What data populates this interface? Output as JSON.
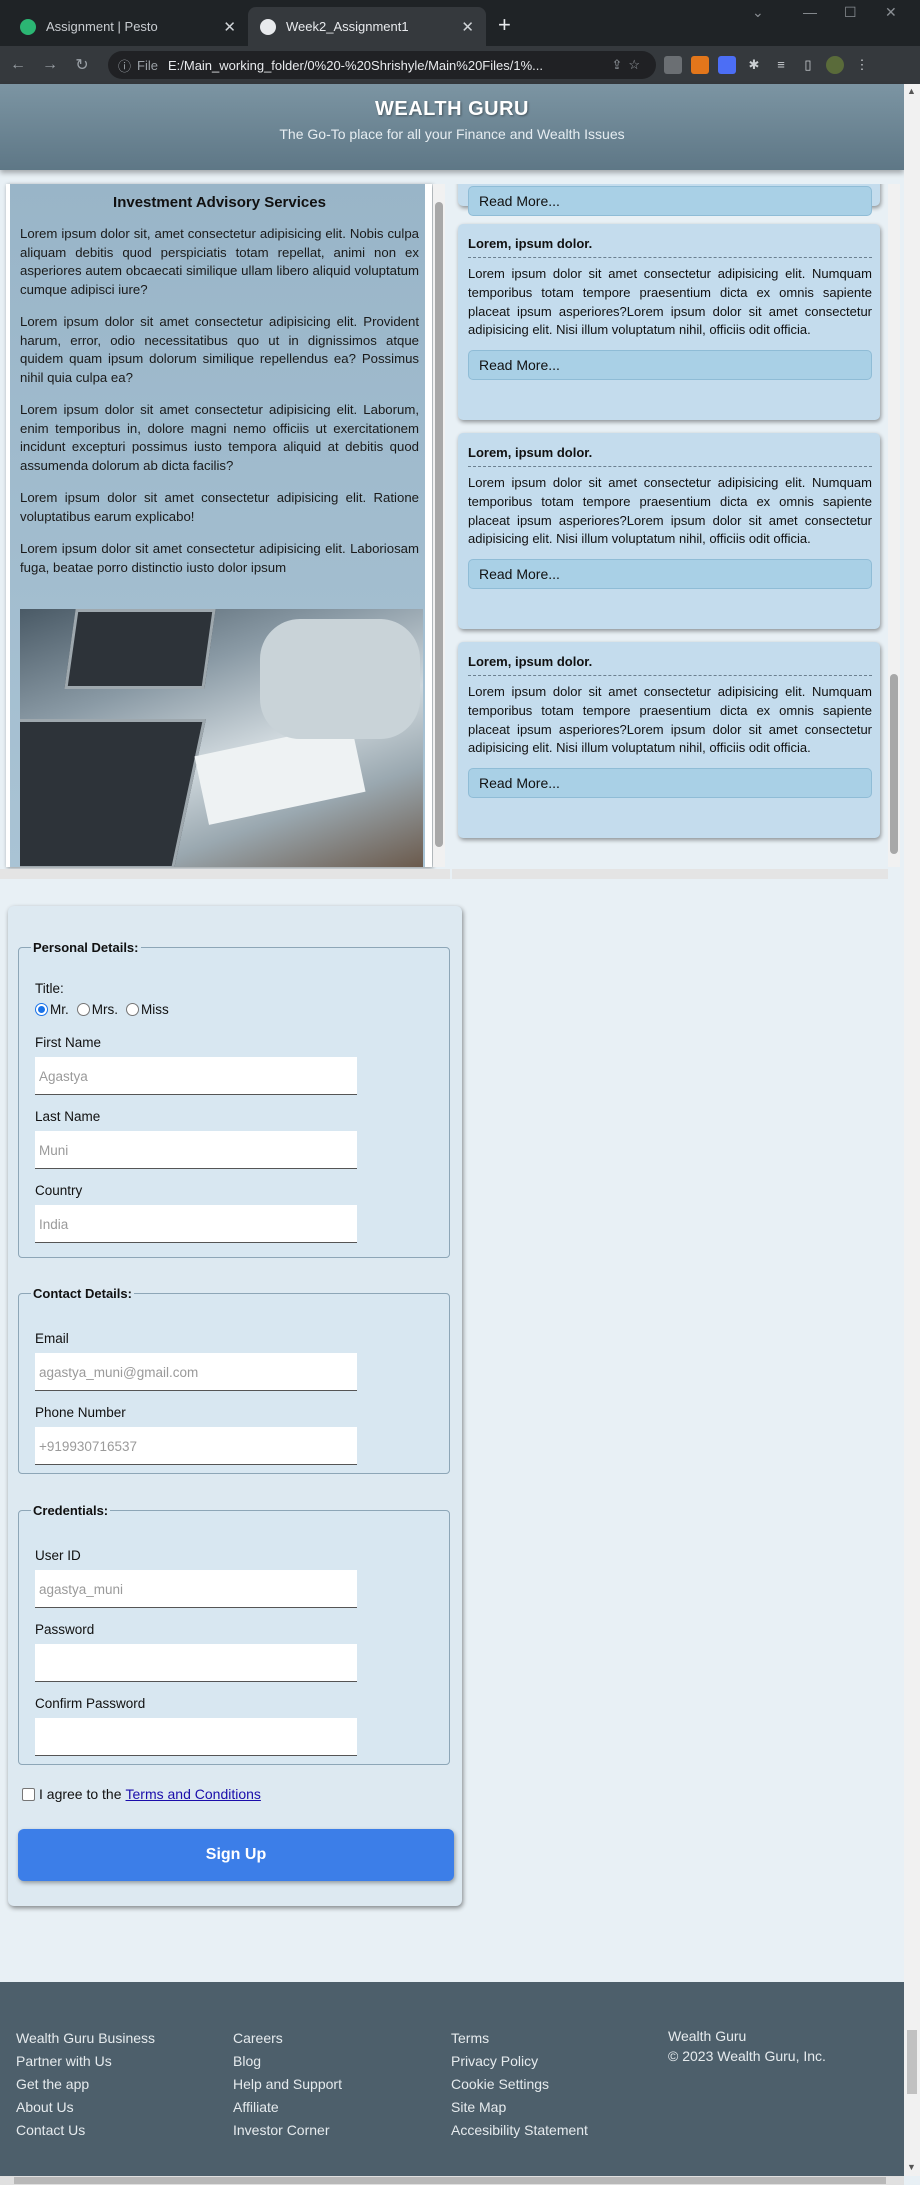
{
  "browser": {
    "tabs": [
      {
        "title": "Assignment | Pesto",
        "active": false
      },
      {
        "title": "Week2_Assignment1",
        "active": true
      }
    ],
    "address": {
      "scheme_label": "File",
      "url": "E:/Main_working_folder/0%20-%20Shrishyle/Main%20Files/1%..."
    }
  },
  "header": {
    "brand": "WEALTH GURU",
    "tagline": "The Go-To place for all your Finance and Wealth Issues"
  },
  "advisory": {
    "title": "Investment Advisory Services",
    "paragraphs": [
      "Lorem ipsum dolor sit, amet consectetur adipisicing elit. Nobis culpa aliquam debitis quod perspiciatis totam repellat, animi non ex asperiores autem obcaecati similique ullam libero aliquid voluptatum cumque adipisci iure?",
      "Lorem ipsum dolor sit amet consectetur adipisicing elit. Provident harum, error, odio necessitatibus quo ut in dignissimos atque quidem quam ipsum dolorum similique repellendus ea? Possimus nihil quia culpa ea?",
      "Lorem ipsum dolor sit amet consectetur adipisicing elit. Laborum, enim temporibus in, dolore magni nemo officiis ut exercitationem incidunt excepturi possimus iusto tempora aliquid at debitis quod assumenda dolorum ab dicta facilis?",
      "Lorem ipsum dolor sit amet consectetur adipisicing elit. Ratione voluptatibus earum explicabo!",
      "Lorem ipsum dolor sit amet consectetur adipisicing elit. Laboriosam fuga, beatae porro distinctio iusto dolor ipsum"
    ]
  },
  "articles": {
    "read_more": "Read More...",
    "cards": [
      {
        "title": "Lorem, ipsum dolor.",
        "body": "Lorem ipsum dolor sit amet consectetur adipisicing elit. Numquam temporibus totam tempore praesentium dicta ex omnis sapiente placeat ipsum asperiores?Lorem ipsum dolor sit amet consectetur adipisicing elit. Nisi illum voluptatum nihil, officiis odit officia."
      },
      {
        "title": "Lorem, ipsum dolor.",
        "body": "Lorem ipsum dolor sit amet consectetur adipisicing elit. Numquam temporibus totam tempore praesentium dicta ex omnis sapiente placeat ipsum asperiores?Lorem ipsum dolor sit amet consectetur adipisicing elit. Nisi illum voluptatum nihil, officiis odit officia."
      },
      {
        "title": "Lorem, ipsum dolor.",
        "body": "Lorem ipsum dolor sit amet consectetur adipisicing elit. Numquam temporibus totam tempore praesentium dicta ex omnis sapiente placeat ipsum asperiores?Lorem ipsum dolor sit amet consectetur adipisicing elit. Nisi illum voluptatum nihil, officiis odit officia."
      }
    ]
  },
  "form": {
    "personal": {
      "legend": "Personal Details:",
      "title_label": "Title:",
      "title_options": [
        "Mr.",
        "Mrs.",
        "Miss"
      ],
      "title_selected": "Mr.",
      "first_name_label": "First Name",
      "first_name_placeholder": "Agastya",
      "last_name_label": "Last Name",
      "last_name_placeholder": "Muni",
      "country_label": "Country",
      "country_placeholder": "India"
    },
    "contact": {
      "legend": "Contact Details:",
      "email_label": "Email",
      "email_placeholder": "agastya_muni@gmail.com",
      "phone_label": "Phone Number",
      "phone_placeholder": "+919930716537"
    },
    "credentials": {
      "legend": "Credentials:",
      "userid_label": "User ID",
      "userid_placeholder": "agastya_muni",
      "password_label": "Password",
      "password_value": "",
      "confirm_label": "Confirm Password",
      "confirm_value": ""
    },
    "agree_text": "I agree to the",
    "terms_link": "Terms and Conditions",
    "submit": "Sign Up"
  },
  "footer": {
    "col1": [
      "Wealth Guru Business",
      "Partner with Us",
      "Get the app",
      "About Us",
      "Contact Us"
    ],
    "col2": [
      "Careers",
      "Blog",
      "Help and Support",
      "Affiliate",
      "Investor Corner"
    ],
    "col3": [
      "Terms",
      "Privacy Policy",
      "Cookie Settings",
      "Site Map",
      "Accesibility Statement"
    ],
    "brand": "Wealth Guru",
    "copyright": "© 2023 Wealth Guru, Inc."
  }
}
